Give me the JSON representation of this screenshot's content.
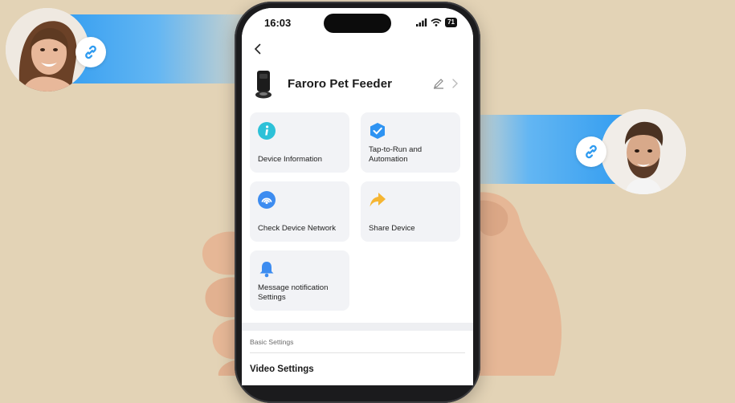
{
  "status_bar": {
    "time": "16:03",
    "battery": "71"
  },
  "device": {
    "name": "Faroro Pet Feeder"
  },
  "cards": [
    {
      "label": "Device Information",
      "icon": "info-icon"
    },
    {
      "label": "Tap-to-Run and Automation",
      "icon": "automation-check-icon"
    },
    {
      "label": "Check Device Network",
      "icon": "network-signal-icon"
    },
    {
      "label": "Share Device",
      "icon": "share-arrow-icon"
    },
    {
      "label": "Message notification Settings",
      "icon": "bell-icon"
    }
  ],
  "sections": {
    "basic_settings": "Basic Settings",
    "video_settings": "Video Settings"
  },
  "colors": {
    "background": "#e3d3b6",
    "accent_blue": "#2f9bf0",
    "card_bg": "#f2f3f6",
    "share_orange": "#f5b532"
  }
}
